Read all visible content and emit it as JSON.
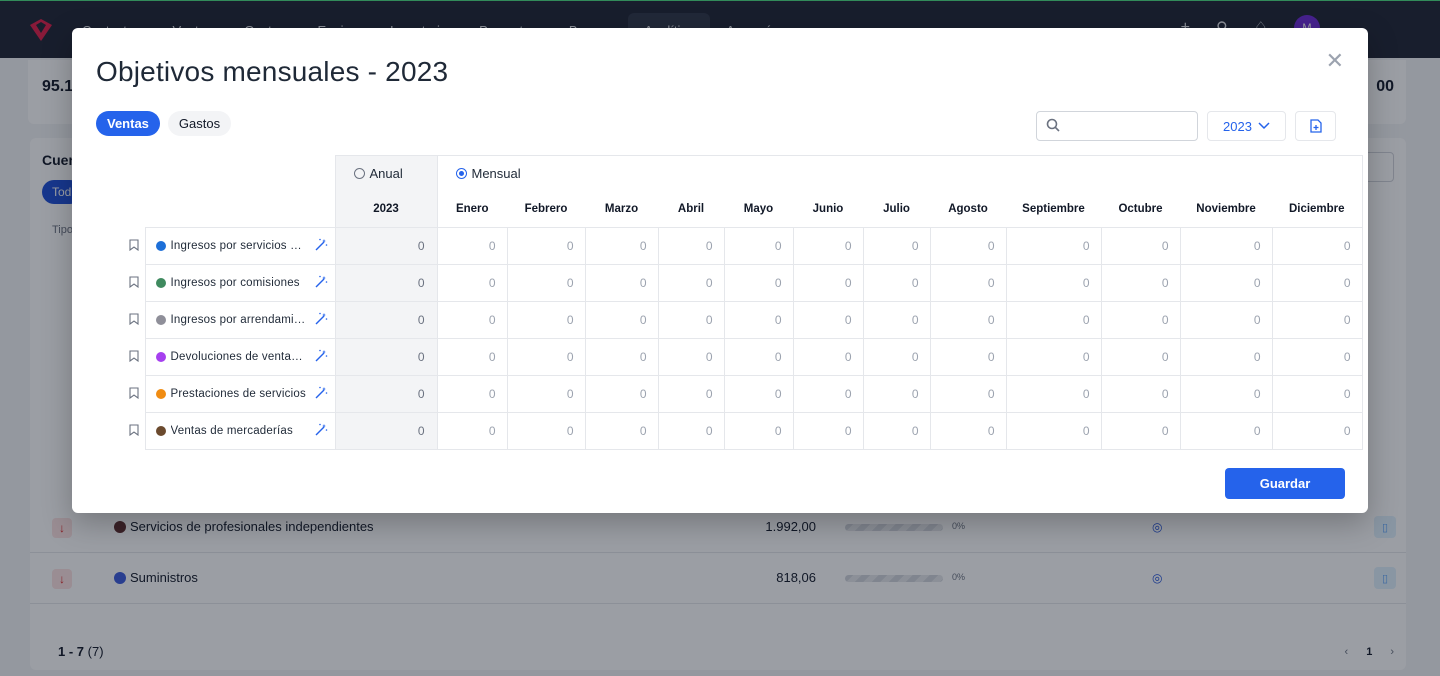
{
  "background": {
    "nav": [
      "Contactos",
      "Ventas",
      "Gastos",
      "Equipo",
      "Inventario",
      "Proyectos",
      "Bancos",
      "Analítica",
      "Asesoría"
    ],
    "active_nav": "Analítica",
    "avatar_initials": "M",
    "stat_left": "95.1",
    "stat_right": "00",
    "card_title": "Cuen",
    "chip": "Tod",
    "col_head": "Tipo",
    "rows": [
      {
        "name": "Servicios de profesionales independientes",
        "amount": "1.992,00",
        "pct": "0%",
        "dir": "down",
        "color": "#5b2a2a"
      },
      {
        "name": "Suministros",
        "amount": "818,06",
        "pct": "0%",
        "dir": "down",
        "color": "#3b5bdb"
      }
    ],
    "pager_range": "1 - 7",
    "pager_total": "(7)",
    "page": "1"
  },
  "modal": {
    "title": "Objetivos mensuales - 2023",
    "tabs": [
      {
        "label": "Ventas",
        "active": true
      },
      {
        "label": "Gastos",
        "active": false
      }
    ],
    "year": "2023",
    "radio_annual": "Anual",
    "radio_monthly": "Mensual",
    "annual_col_header": "2023",
    "months": [
      "Enero",
      "Febrero",
      "Marzo",
      "Abril",
      "Mayo",
      "Junio",
      "Julio",
      "Agosto",
      "Septiembre",
      "Octubre",
      "Noviembre",
      "Diciembre"
    ],
    "rows": [
      {
        "name": "Ingresos por servicios de diversa índole",
        "display": "Ingresos por servicios d...",
        "color": "#1d6fd8",
        "annual": "0",
        "values": [
          "0",
          "0",
          "0",
          "0",
          "0",
          "0",
          "0",
          "0",
          "0",
          "0",
          "0",
          "0"
        ]
      },
      {
        "name": "Ingresos por comisiones",
        "display": "Ingresos por comisiones",
        "color": "#3f8a5f",
        "annual": "0",
        "values": [
          "0",
          "0",
          "0",
          "0",
          "0",
          "0",
          "0",
          "0",
          "0",
          "0",
          "0",
          "0"
        ]
      },
      {
        "name": "Ingresos por arrendamientos",
        "display": "Ingresos por arrendamie...",
        "color": "#8f8f99",
        "annual": "0",
        "values": [
          "0",
          "0",
          "0",
          "0",
          "0",
          "0",
          "0",
          "0",
          "0",
          "0",
          "0",
          "0"
        ]
      },
      {
        "name": "Devoluciones de ventas y operaciones similares",
        "display": "Devoluciones de ventas ...",
        "color": "#a640ef",
        "annual": "0",
        "values": [
          "0",
          "0",
          "0",
          "0",
          "0",
          "0",
          "0",
          "0",
          "0",
          "0",
          "0",
          "0"
        ]
      },
      {
        "name": "Prestaciones de servicios",
        "display": "Prestaciones de servicios",
        "color": "#f08c12",
        "annual": "0",
        "values": [
          "0",
          "0",
          "0",
          "0",
          "0",
          "0",
          "0",
          "0",
          "0",
          "0",
          "0",
          "0"
        ]
      },
      {
        "name": "Ventas de mercaderías",
        "display": "Ventas de mercaderías",
        "color": "#6b4a2e",
        "annual": "0",
        "values": [
          "0",
          "0",
          "0",
          "0",
          "0",
          "0",
          "0",
          "0",
          "0",
          "0",
          "0",
          "0"
        ]
      }
    ],
    "save_label": "Guardar",
    "colors": {
      "accent": "#2563eb"
    }
  }
}
